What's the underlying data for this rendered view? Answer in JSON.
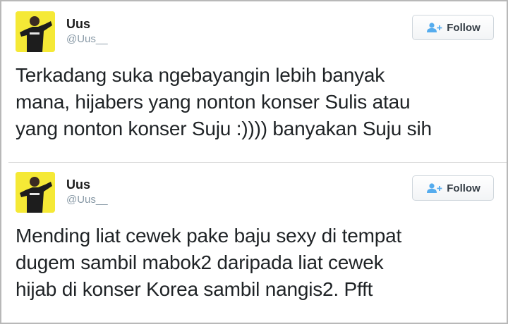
{
  "tweets": [
    {
      "user": {
        "name": "Uus",
        "handle": "@Uus__"
      },
      "follow_label": "Follow",
      "text_lines": [
        "Terkadang suka ngebayangin lebih banyak",
        "mana, hijabers yang nonton konser Sulis atau",
        "yang nonton konser Suju :)))) banyakan Suju sih"
      ]
    },
    {
      "user": {
        "name": "Uus",
        "handle": "@Uus__"
      },
      "follow_label": "Follow",
      "text_lines": [
        "Mending liat cewek pake baju sexy di tempat",
        "dugem sambil mabok2 daripada liat cewek",
        "hijab di konser Korea sambil nangis2. Pfft"
      ]
    }
  ],
  "colors": {
    "avatar_bg": "#f5e936",
    "follow_icon": "#55acee",
    "handle": "#8899a6"
  },
  "icons": {
    "avatar": "avatar-image",
    "follow": "add-user-icon"
  }
}
